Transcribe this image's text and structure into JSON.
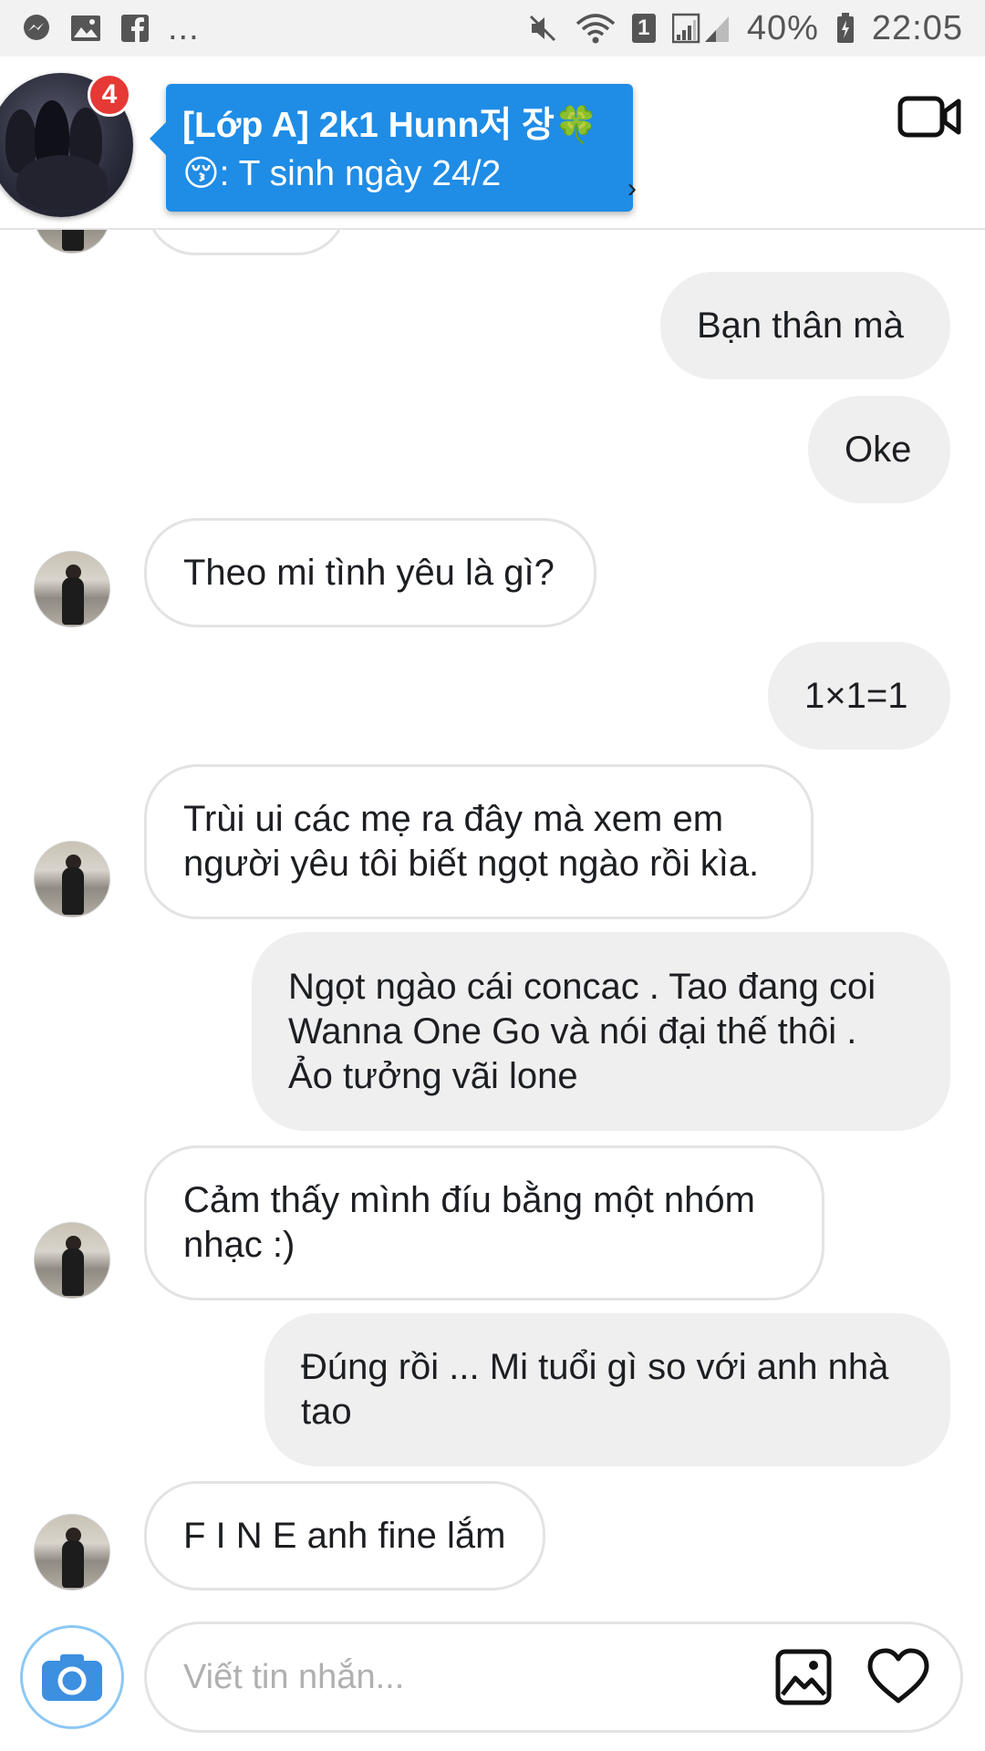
{
  "status_bar": {
    "left_more": "...",
    "sim_slot": "1",
    "battery": "40%",
    "time": "22:05"
  },
  "header": {
    "badge_count": "4",
    "group_name": "[Lớp A] 2k1 Hunn저 장🍀",
    "last_message": "😚: T sinh ngày 24/2"
  },
  "messages": [
    {
      "side": "out",
      "text": "Bạn thân mà"
    },
    {
      "side": "out",
      "text": "Oke"
    },
    {
      "side": "in",
      "text": "Theo mi tình yêu là gì?"
    },
    {
      "side": "out",
      "text": "1×1=1"
    },
    {
      "side": "in",
      "lines": [
        "Trùi ui các mẹ ra đây mà xem em",
        "người yêu tôi biết ngọt ngào rồi kìa."
      ]
    },
    {
      "side": "out",
      "lines": [
        "Ngọt ngào cái concac . Tao đang coi",
        "Wanna One Go và nói đại thế thôi .",
        "Ảo tưởng vãi lone"
      ]
    },
    {
      "side": "in",
      "lines": [
        "Cảm thấy mình đíu bằng một nhóm",
        "nhạc :)"
      ]
    },
    {
      "side": "out",
      "lines": [
        "Đúng rồi ... Mi tuổi gì so với anh nhà",
        "tao"
      ]
    },
    {
      "side": "in",
      "text": "F I N E anh fine lắm"
    }
  ],
  "composer": {
    "placeholder": "Viết tin nhắn..."
  },
  "colors": {
    "tooltip_blue": "#1f8ce6",
    "badge_red": "#e53935",
    "outgoing_bubble": "#efefef",
    "camera_blue": "#3d8fe0"
  },
  "icons": [
    "messenger-icon",
    "gallery-icon",
    "facebook-icon",
    "mute-icon",
    "wifi-icon",
    "signal-icon",
    "battery-icon",
    "video-call-icon",
    "camera-icon",
    "image-icon",
    "heart-icon"
  ]
}
